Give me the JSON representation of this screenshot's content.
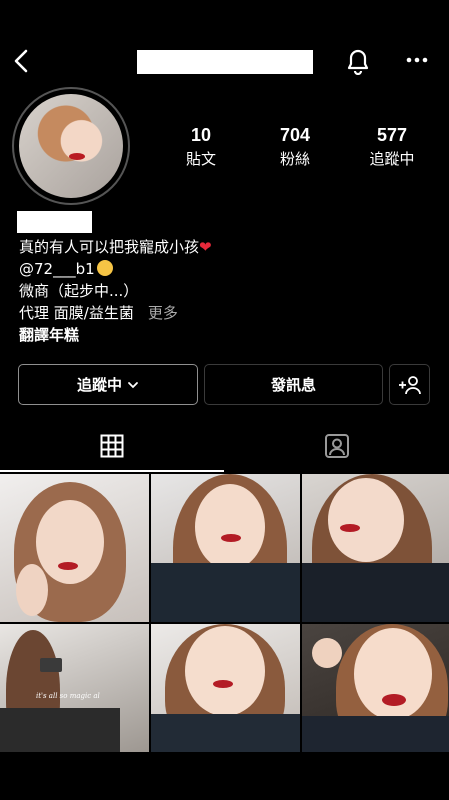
{
  "header": {
    "back_icon": "chevron-left-icon",
    "notification_icon": "bell-icon",
    "more_icon": "more-horizontal-icon"
  },
  "stats": {
    "posts": {
      "count": "10",
      "label": "貼文"
    },
    "followers": {
      "count": "704",
      "label": "粉絲"
    },
    "following": {
      "count": "577",
      "label": "追蹤中"
    }
  },
  "bio": {
    "line1": "真的有人可以把我寵成小孩",
    "line2": "@72___b1",
    "line3": "微商（起步中...）",
    "line4": "代理 面膜/益生菌",
    "more": "更多",
    "translate": "翻譯年糕"
  },
  "actions": {
    "following_label": "追蹤中",
    "message_label": "發訊息",
    "add_user_icon": "add-user-icon"
  },
  "tabs": {
    "grid_icon": "grid-icon",
    "tagged_icon": "tagged-user-icon"
  },
  "posts": [
    {
      "caption": ""
    },
    {
      "caption": ""
    },
    {
      "caption": ""
    },
    {
      "caption": "it's all so magic al"
    },
    {
      "caption": ""
    },
    {
      "caption": ""
    }
  ]
}
